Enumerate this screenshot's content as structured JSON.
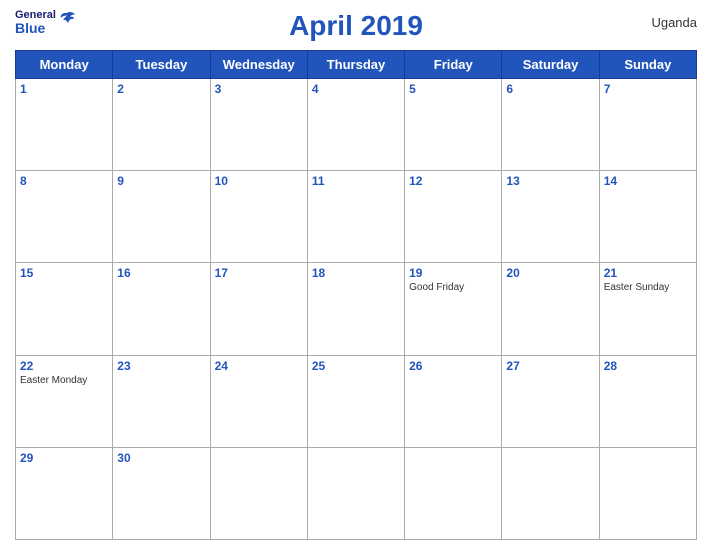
{
  "header": {
    "title": "April 2019",
    "country": "Uganda",
    "logo": {
      "general": "General",
      "blue": "Blue"
    }
  },
  "weekdays": [
    "Monday",
    "Tuesday",
    "Wednesday",
    "Thursday",
    "Friday",
    "Saturday",
    "Sunday"
  ],
  "weeks": [
    [
      {
        "day": 1,
        "holiday": ""
      },
      {
        "day": 2,
        "holiday": ""
      },
      {
        "day": 3,
        "holiday": ""
      },
      {
        "day": 4,
        "holiday": ""
      },
      {
        "day": 5,
        "holiday": ""
      },
      {
        "day": 6,
        "holiday": ""
      },
      {
        "day": 7,
        "holiday": ""
      }
    ],
    [
      {
        "day": 8,
        "holiday": ""
      },
      {
        "day": 9,
        "holiday": ""
      },
      {
        "day": 10,
        "holiday": ""
      },
      {
        "day": 11,
        "holiday": ""
      },
      {
        "day": 12,
        "holiday": ""
      },
      {
        "day": 13,
        "holiday": ""
      },
      {
        "day": 14,
        "holiday": ""
      }
    ],
    [
      {
        "day": 15,
        "holiday": ""
      },
      {
        "day": 16,
        "holiday": ""
      },
      {
        "day": 17,
        "holiday": ""
      },
      {
        "day": 18,
        "holiday": ""
      },
      {
        "day": 19,
        "holiday": "Good Friday"
      },
      {
        "day": 20,
        "holiday": ""
      },
      {
        "day": 21,
        "holiday": "Easter Sunday"
      }
    ],
    [
      {
        "day": 22,
        "holiday": "Easter Monday"
      },
      {
        "day": 23,
        "holiday": ""
      },
      {
        "day": 24,
        "holiday": ""
      },
      {
        "day": 25,
        "holiday": ""
      },
      {
        "day": 26,
        "holiday": ""
      },
      {
        "day": 27,
        "holiday": ""
      },
      {
        "day": 28,
        "holiday": ""
      }
    ],
    [
      {
        "day": 29,
        "holiday": ""
      },
      {
        "day": 30,
        "holiday": ""
      },
      {
        "day": null,
        "holiday": ""
      },
      {
        "day": null,
        "holiday": ""
      },
      {
        "day": null,
        "holiday": ""
      },
      {
        "day": null,
        "holiday": ""
      },
      {
        "day": null,
        "holiday": ""
      }
    ]
  ]
}
